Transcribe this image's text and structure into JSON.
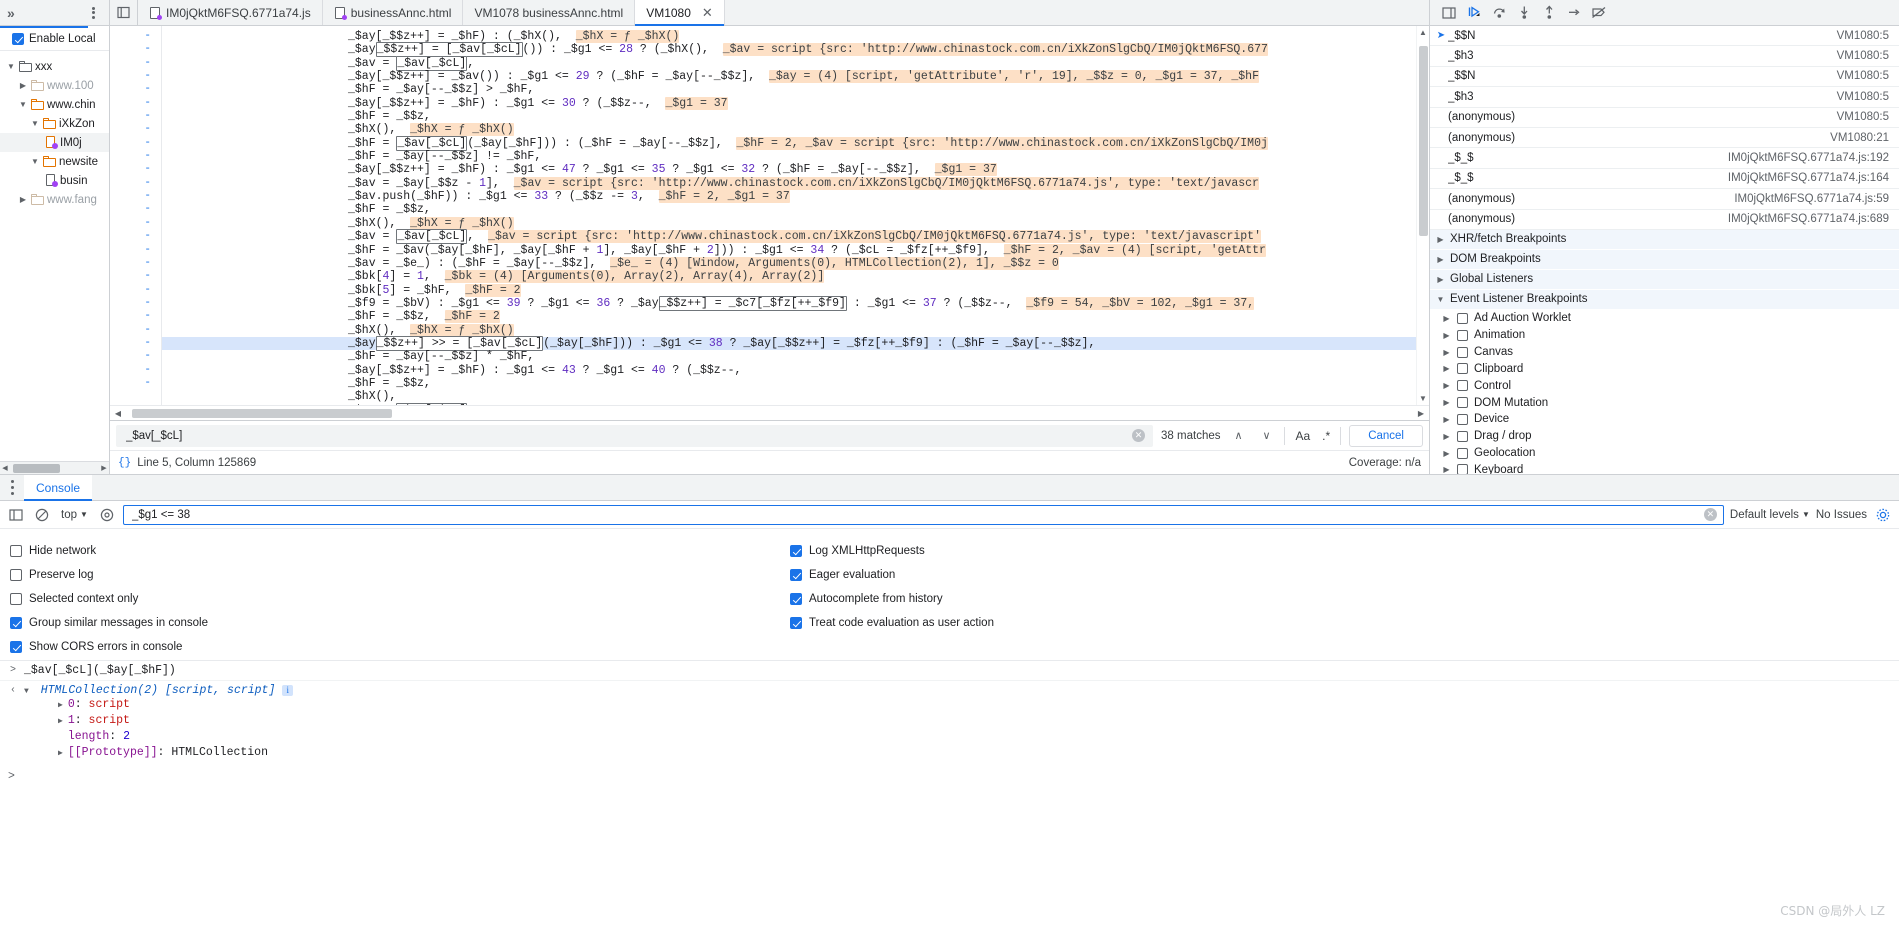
{
  "window": {
    "title": "Chrome DevTools - Sources"
  },
  "toolbar": {
    "more_tabs_label": "»",
    "kebab_label": "More options",
    "panel_toggle_label": "toggle-navigator"
  },
  "tabs": [
    {
      "label": "IM0jQktM6FSQ.6771a74.js",
      "icon": "js-file-icon",
      "active": false,
      "closable": false
    },
    {
      "label": "businessAnnc.html",
      "icon": "html-file-icon",
      "active": false,
      "closable": false
    },
    {
      "label": "VM1078 businessAnnc.html",
      "icon": "none",
      "active": false,
      "closable": false
    },
    {
      "label": "VM1080",
      "icon": "none",
      "active": true,
      "closable": true
    }
  ],
  "navigator": {
    "enable_local_label": "Enable Local",
    "tree": [
      {
        "label": "xxx",
        "depth": 0,
        "type": "folder",
        "expanded": true,
        "dim": false,
        "selected": false
      },
      {
        "label": "www.100",
        "depth": 1,
        "type": "folder-grey",
        "expanded": false,
        "dim": true,
        "selected": false
      },
      {
        "label": "www.chin",
        "depth": 1,
        "type": "folder",
        "expanded": true,
        "dim": false,
        "selected": false
      },
      {
        "label": "iXkZon",
        "depth": 2,
        "type": "folder",
        "expanded": true,
        "dim": false,
        "selected": false
      },
      {
        "label": "IM0j",
        "depth": 3,
        "type": "js-file",
        "expanded": false,
        "dim": false,
        "selected": true
      },
      {
        "label": "newsite",
        "depth": 2,
        "type": "folder",
        "expanded": true,
        "dim": false,
        "selected": false
      },
      {
        "label": "busin",
        "depth": 3,
        "type": "html-file",
        "expanded": false,
        "dim": false,
        "selected": false
      },
      {
        "label": "www.fang",
        "depth": 1,
        "type": "folder-grey",
        "expanded": false,
        "dim": true,
        "selected": false
      }
    ]
  },
  "editor": {
    "gutter_marker": "-",
    "line_count": 27,
    "lines": [
      "_$ay[_$$z++] = _$hF) : (_$hX(),  ||_$hX = ƒ _$hX()",
      "_$ay[_$$z++] = [_$av[_$cL]]()) : _$g1 <= #28 ? (_$hX(),  ||_$av = script {src: 'http://www.chinastock.com.cn/iXkZonSlgCbQ/IM0jQktM6FSQ.677",
      "_$av = [_$av[_$cL]],",
      "_$ay[_$$z++] = _$av()) : _$g1 <= #29 ? (_$hF = _$ay[--_$$z],  ||_$ay = (4) [script, 'getAttribute', 'r', 19], _$$z = 0, _$g1 = 37, _$hF",
      "_$hF = _$ay[--_$$z] > _$hF,",
      "_$ay[_$$z++] = _$hF) : _$g1 <= #30 ? (_$$z--,  ||_$g1 = 37",
      "_$hF = _$$z,",
      "_$hX(),  ||_$hX = ƒ _$hX()",
      "_$hF = [_$av[_$cL]](_$ay[_$hF])) : (_$hF = _$ay[--_$$z],  ||_$hF = 2, _$av = script {src: 'http://www.chinastock.com.cn/iXkZonSlgCbQ/IM0j",
      "_$hF = _$ay[--_$$z] != _$hF,",
      "_$ay[_$$z++] = _$hF) : _$g1 <= #47 ? _$g1 <= #35 ? _$g1 <= #32 ? (_$hF = _$ay[--_$$z],  ||_$g1 = 37",
      "_$av = _$ay[_$$z - #1],  ||_$av = script {src: 'http://www.chinastock.com.cn/iXkZonSlgCbQ/IM0jQktM6FSQ.6771a74.js', type: 'text/javascr",
      "_$av.push(_$hF)) : _$g1 <= #33 ? (_$$z -= #3,  ||_$hF = 2, _$g1 = 37",
      "_$hF = _$$z,",
      "_$hX(),  ||_$hX = ƒ _$hX()",
      "_$av = [_$av[_$cL]],  ||_$av = script {src: 'http://www.chinastock.com.cn/iXkZonSlgCbQ/IM0jQktM6FSQ.6771a74.js', type: 'text/javascript'",
      "_$hF = _$av(_$ay[_$hF], _$ay[_$hF + #1], _$ay[_$hF + #2])) : _$g1 <= #34 ? (_$cL = _$fz[++_$f9],  ||_$hF = 2, _$av = (4) [script, 'getAttr",
      "_$av = _$e_) : (_$hF = _$ay[--_$$z],  ||_$e_ = (4) [Window, Arguments(0), HTMLCollection(2), 1], _$$z = 0",
      "_$bk[#4] = #1,  ||_$bk = (4) [Arguments(0), Array(2), Array(4), Array(2)]",
      "_$bk[#5] = _$hF,  ||_$hF = 2",
      "_$f9 = _$bV) : _$g1 <= #39 ? _$g1 <= #36 ? _$ay[_$$z++] = _$c7[_$fz[++_$f9]] : _$g1 <= #37 ? (_$$z--,  ||_$f9 = 54, _$bV = 102, _$g1 = 37,",
      "_$hF = _$$z,  ||_$hF = 2",
      "_$hX(),  ||_$hX = ƒ _$hX()",
      "_$ay[_$$z++] >> = [_$av[_$cL]](_$ay[_$hF])) : _$g1 <= #38 ? _$ay[_$$z++] = _$fz[++_$f9] : (_$hF = _$ay[--_$$z],",
      "_$hF = _$ay[--_$$z] * _$hF,",
      "_$ay[_$$z++] = _$hF) : _$g1 <= #43 ? _$g1 <= #40 ? (_$$z--,",
      "_$hF = _$$z,",
      "_$hX(),",
      "_$av = [_$av[_$cL]]"
    ],
    "highlighted_line_index": 23
  },
  "search": {
    "value": "_$av[_$cL]",
    "placeholder": "Find",
    "match_count_label": "38 matches",
    "prev_label": "∧",
    "next_label": "∨",
    "match_case_label": "Aa",
    "regex_label": ".*",
    "cancel_label": "Cancel"
  },
  "status": {
    "format_icon": "{}",
    "position_label": "Line 5, Column 125869",
    "coverage_label": "Coverage: n/a"
  },
  "debugger": {
    "toolbar_icons": [
      "resume-script-icon",
      "step-over-icon",
      "step-into-icon",
      "step-out-icon",
      "step-icon",
      "deactivate-breakpoints-icon"
    ],
    "call_stack": [
      {
        "name": "_$$N",
        "location": "VM1080:5",
        "current": true
      },
      {
        "name": "_$h3",
        "location": "VM1080:5",
        "current": false
      },
      {
        "name": "_$$N",
        "location": "VM1080:5",
        "current": false
      },
      {
        "name": "_$h3",
        "location": "VM1080:5",
        "current": false
      },
      {
        "name": "(anonymous)",
        "location": "VM1080:5",
        "current": false
      },
      {
        "name": "(anonymous)",
        "location": "VM1080:21",
        "current": false
      },
      {
        "name": "_$_$",
        "location": "IM0jQktM6FSQ.6771a74.js:192",
        "current": false
      },
      {
        "name": "_$_$",
        "location": "IM0jQktM6FSQ.6771a74.js:164",
        "current": false
      },
      {
        "name": "(anonymous)",
        "location": "IM0jQktM6FSQ.6771a74.js:59",
        "current": false
      },
      {
        "name": "(anonymous)",
        "location": "IM0jQktM6FSQ.6771a74.js:689",
        "current": false
      }
    ],
    "sections": [
      {
        "label": "XHR/fetch Breakpoints",
        "expanded": false
      },
      {
        "label": "DOM Breakpoints",
        "expanded": false
      },
      {
        "label": "Global Listeners",
        "expanded": false
      },
      {
        "label": "Event Listener Breakpoints",
        "expanded": true
      }
    ],
    "event_listener_breakpoints": [
      {
        "label": "Ad Auction Worklet",
        "checked": false
      },
      {
        "label": "Animation",
        "checked": false
      },
      {
        "label": "Canvas",
        "checked": false
      },
      {
        "label": "Clipboard",
        "checked": false
      },
      {
        "label": "Control",
        "checked": false
      },
      {
        "label": "DOM Mutation",
        "checked": false
      },
      {
        "label": "Device",
        "checked": false
      },
      {
        "label": "Drag / drop",
        "checked": false
      },
      {
        "label": "Geolocation",
        "checked": false
      },
      {
        "label": "Keyboard",
        "checked": false
      }
    ]
  },
  "console": {
    "tab_label": "Console",
    "context_label": "top",
    "filter_value": "_$g1 <= 38",
    "filter_placeholder": "Filter",
    "levels_label": "Default levels",
    "issues_label": "No Issues",
    "settings_left": [
      {
        "label": "Hide network",
        "checked": false
      },
      {
        "label": "Preserve log",
        "checked": false
      },
      {
        "label": "Selected context only",
        "checked": false
      },
      {
        "label": "Group similar messages in console",
        "checked": true
      },
      {
        "label": "Show CORS errors in console",
        "checked": true
      }
    ],
    "settings_right": [
      {
        "label": "Log XMLHttpRequests",
        "checked": true
      },
      {
        "label": "Eager evaluation",
        "checked": true
      },
      {
        "label": "Autocomplete from history",
        "checked": true
      },
      {
        "label": "Treat code evaluation as user action",
        "checked": true
      }
    ],
    "input_expression": "_$av[_$cL](_$ay[_$hF])",
    "result_header": "HTMLCollection(2) [script, script]",
    "result_rows": [
      {
        "tri": true,
        "key": "0",
        "value": "script",
        "value_class": "val-str"
      },
      {
        "tri": true,
        "key": "1",
        "value": "script",
        "value_class": "val-str"
      },
      {
        "tri": false,
        "key": "length",
        "value": "2",
        "value_class": "val-num"
      },
      {
        "tri": true,
        "key": "[[Prototype]]",
        "value": "HTMLCollection",
        "value_class": ""
      }
    ],
    "prompt_symbol": ">"
  },
  "watermark": {
    "text": "CSDN @局外人 LZ"
  },
  "colors": {
    "accent": "#1a73e8",
    "highlight_line": "#d7e5fb",
    "inline_value_bg": "#fde0c6",
    "toolbar_bg": "#f1f3f4",
    "section_bg": "#f1f6fc"
  }
}
